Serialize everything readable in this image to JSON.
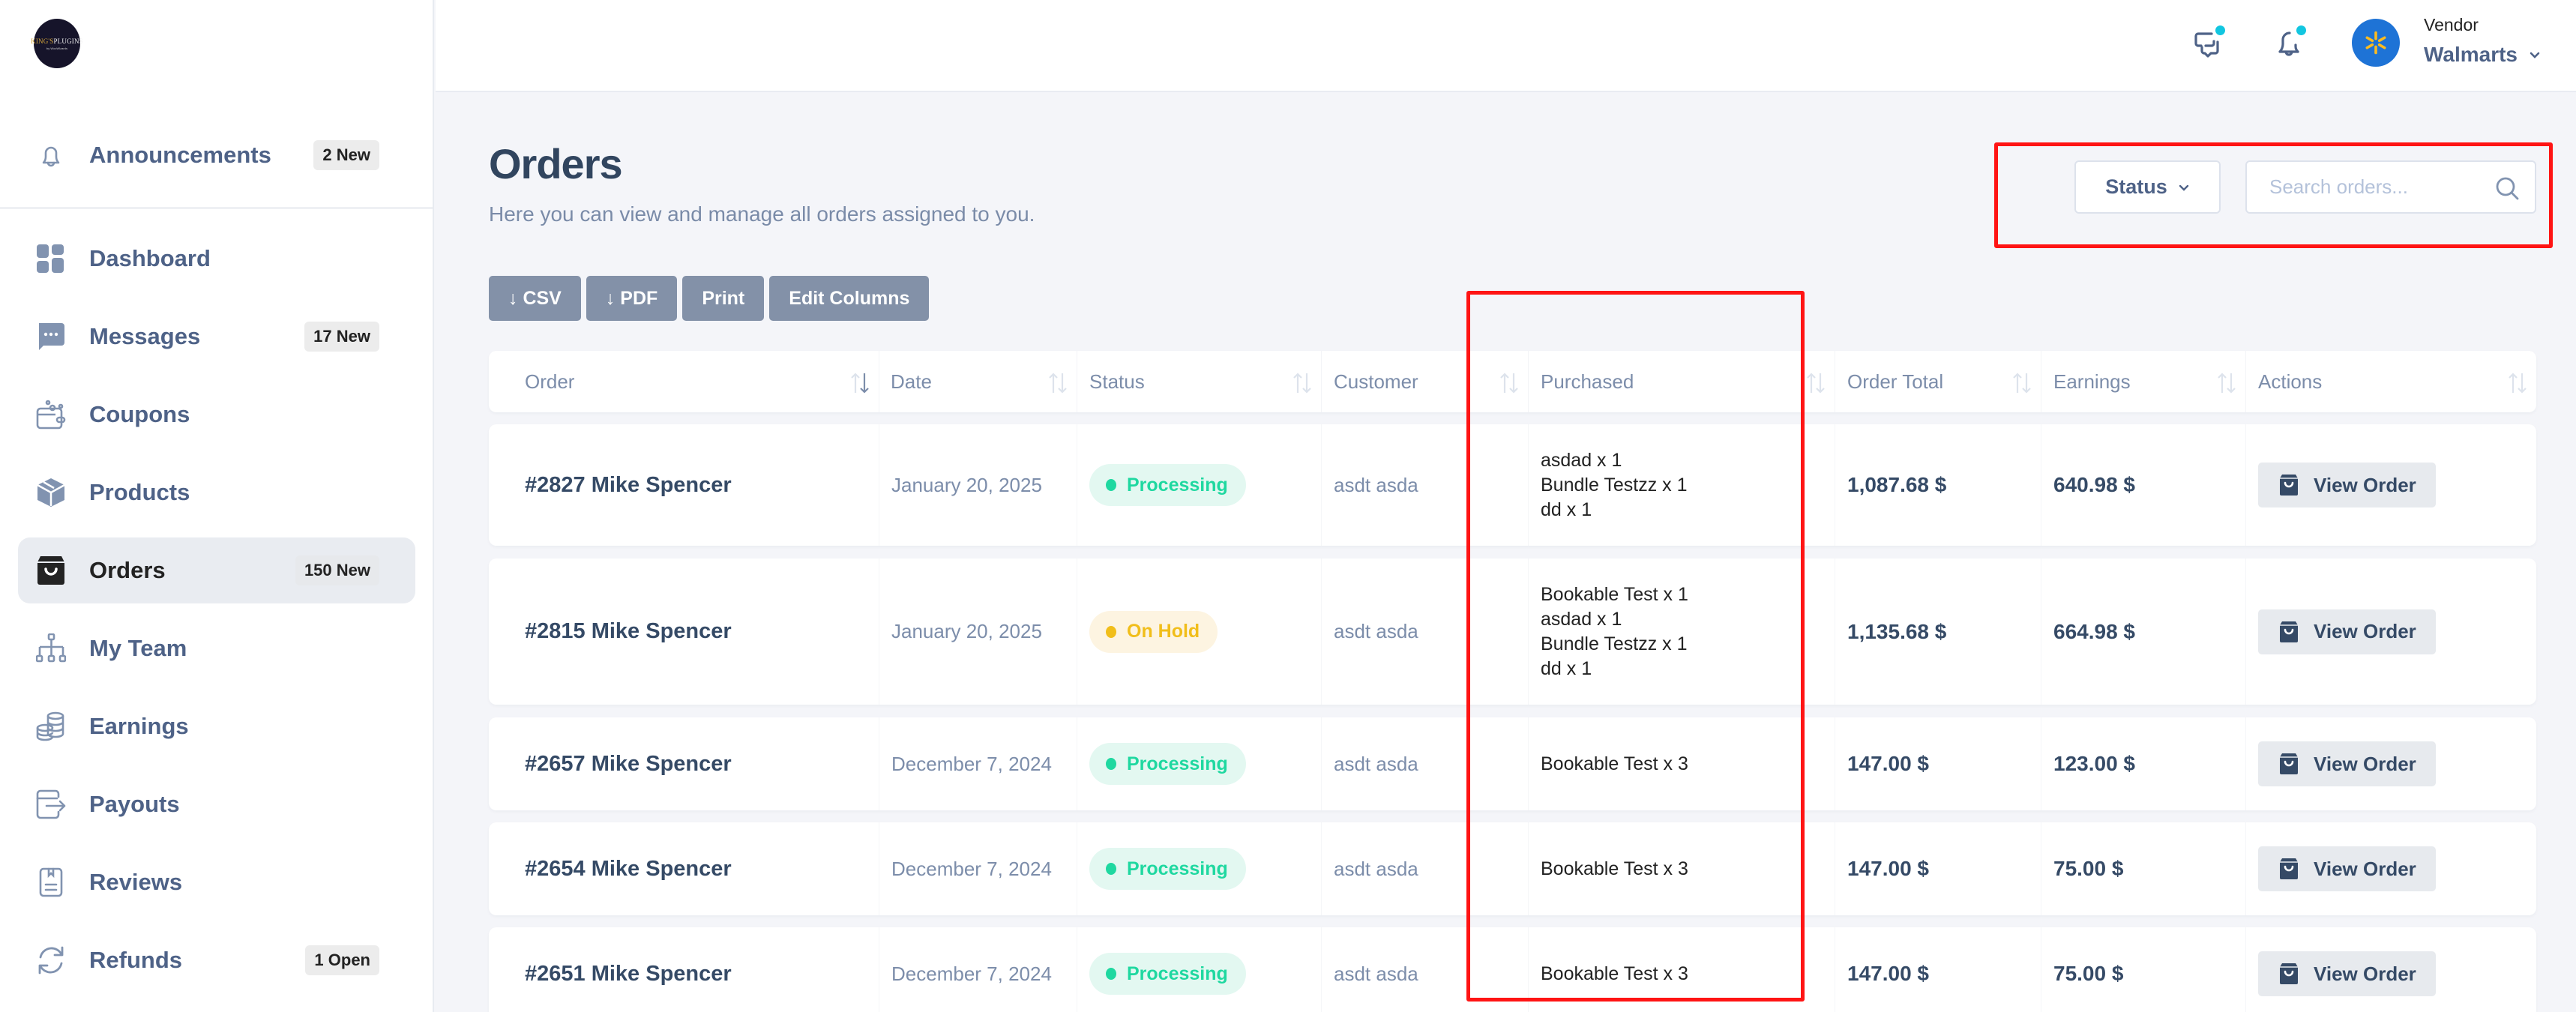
{
  "brand": {
    "logo_line1_a": "KING'S",
    "logo_line1_b": "PLUGINS",
    "logo_line2": "by WooWizards"
  },
  "sidebar": {
    "announcements": {
      "label": "Announcements",
      "badge": "2 New"
    },
    "items": [
      {
        "label": "Dashboard",
        "icon": "dashboard-icon",
        "badge": ""
      },
      {
        "label": "Messages",
        "icon": "chat-icon",
        "badge": "17 New"
      },
      {
        "label": "Coupons",
        "icon": "coupon-icon",
        "badge": ""
      },
      {
        "label": "Products",
        "icon": "box-icon",
        "badge": ""
      },
      {
        "label": "Orders",
        "icon": "shopping-bag-icon",
        "badge": "150 New",
        "active": true
      },
      {
        "label": "My Team",
        "icon": "team-hierarchy-icon",
        "badge": ""
      },
      {
        "label": "Earnings",
        "icon": "coins-icon",
        "badge": ""
      },
      {
        "label": "Payouts",
        "icon": "payout-export-icon",
        "badge": ""
      },
      {
        "label": "Reviews",
        "icon": "review-bookmark-icon",
        "badge": ""
      },
      {
        "label": "Refunds",
        "icon": "refresh-icon",
        "badge": "1 Open"
      }
    ]
  },
  "topbar": {
    "messages_icon": "chat-bubbles-icon",
    "notifications_icon": "bell-icon",
    "user_role": "Vendor",
    "user_name": "Walmarts",
    "accent_dot_color": "#12c6e0",
    "avatar_color": "#1e73d6"
  },
  "page": {
    "title": "Orders",
    "subtitle": "Here you can view and manage all orders assigned to you.",
    "export_buttons": [
      "↓ CSV",
      "↓ PDF",
      "Print",
      "Edit Columns"
    ],
    "status_filter_label": "Status",
    "search_placeholder": "Search orders..."
  },
  "table": {
    "columns": [
      "Order",
      "Date",
      "Status",
      "Customer",
      "Purchased",
      "Order Total",
      "Earnings",
      "Actions"
    ],
    "active_sort": {
      "column": "Order",
      "direction": "desc"
    },
    "view_button_label": "View Order",
    "rows": [
      {
        "order": "#2827 Mike Spencer",
        "date": "January 20, 2025",
        "status": "Processing",
        "status_type": "processing",
        "customer": "asdt asda",
        "purchased": [
          "asdad x 1",
          "Bundle Testzz x 1",
          "dd x 1"
        ],
        "total": "1,087.68 $",
        "earnings": "640.98 $"
      },
      {
        "order": "#2815 Mike Spencer",
        "date": "January 20, 2025",
        "status": "On Hold",
        "status_type": "onhold",
        "customer": "asdt asda",
        "purchased": [
          "Bookable Test x 1",
          "asdad x 1",
          "Bundle Testzz x 1",
          "dd x 1"
        ],
        "total": "1,135.68 $",
        "earnings": "664.98 $"
      },
      {
        "order": "#2657 Mike Spencer",
        "date": "December 7, 2024",
        "status": "Processing",
        "status_type": "processing",
        "customer": "asdt asda",
        "purchased": [
          "Bookable Test x 3"
        ],
        "total": "147.00 $",
        "earnings": "123.00 $"
      },
      {
        "order": "#2654 Mike Spencer",
        "date": "December 7, 2024",
        "status": "Processing",
        "status_type": "processing",
        "customer": "asdt asda",
        "purchased": [
          "Bookable Test x 3"
        ],
        "total": "147.00 $",
        "earnings": "75.00 $"
      },
      {
        "order": "#2651 Mike Spencer",
        "date": "December 7, 2024",
        "status": "Processing",
        "status_type": "processing",
        "customer": "asdt asda",
        "purchased": [
          "Bookable Test x 3"
        ],
        "total": "147.00 $",
        "earnings": "75.00 $"
      }
    ]
  },
  "status_colors": {
    "processing": "#1fd8a0",
    "onhold": "#f1be1a"
  },
  "annotations": {
    "color": "#ff1414",
    "highlighted": [
      "status-filter-and-search",
      "purchased-column"
    ]
  }
}
